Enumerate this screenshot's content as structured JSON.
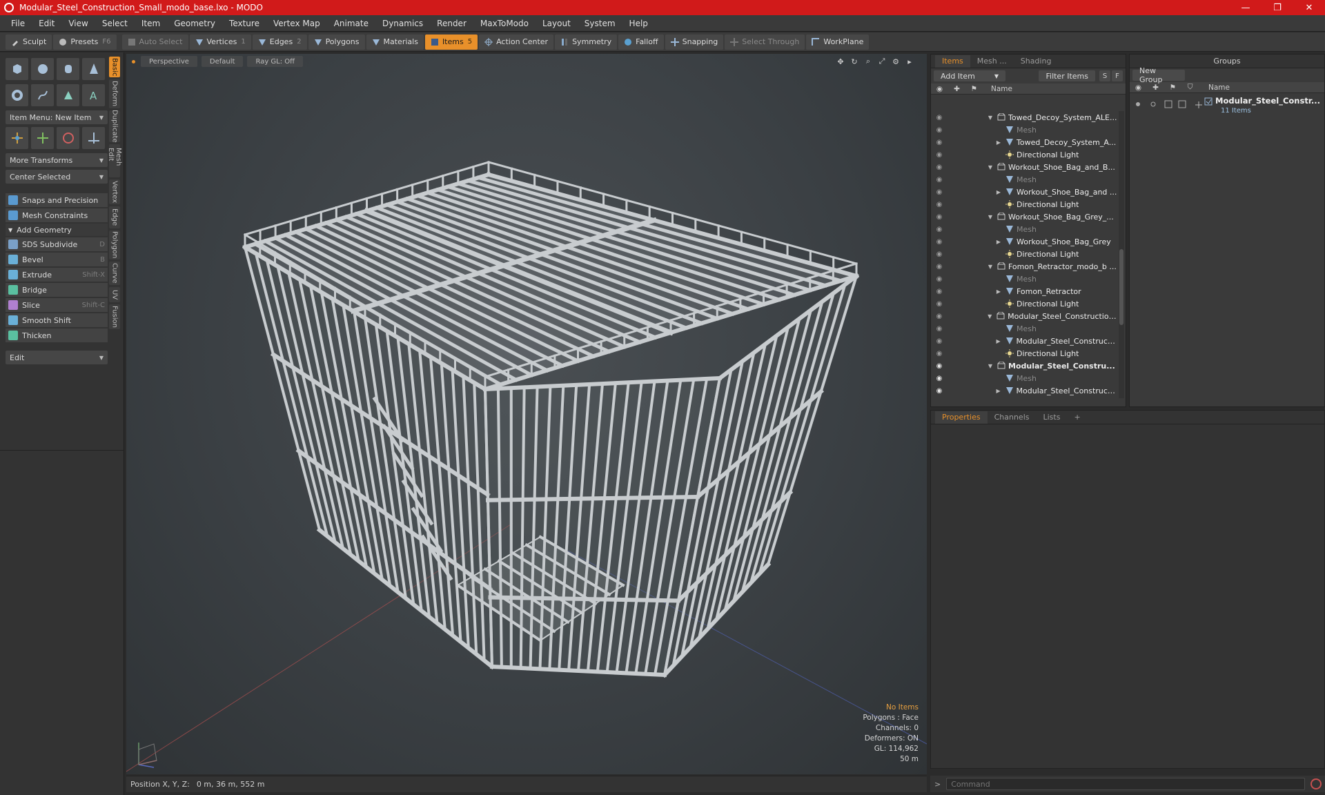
{
  "window": {
    "title": "Modular_Steel_Construction_Small_modo_base.lxo - MODO",
    "controls": [
      "—",
      "❐",
      "✕"
    ]
  },
  "menu": [
    "File",
    "Edit",
    "View",
    "Select",
    "Item",
    "Geometry",
    "Texture",
    "Vertex Map",
    "Animate",
    "Dynamics",
    "Render",
    "MaxToModo",
    "Layout",
    "System",
    "Help"
  ],
  "toolbar": {
    "sculpt": "Sculpt",
    "presets": "Presets",
    "presets_key": "F6",
    "auto_select": "Auto Select",
    "vertices": "Vertices",
    "vertices_count": "1",
    "edges": "Edges",
    "edges_count": "2",
    "polygons": "Polygons",
    "materials": "Materials",
    "items": "Items",
    "items_count": "5",
    "action_center": "Action Center",
    "symmetry": "Symmetry",
    "falloff": "Falloff",
    "snapping": "Snapping",
    "select_through": "Select Through",
    "workplane": "WorkPlane"
  },
  "left_panel": {
    "item_menu": "Item Menu: New Item",
    "more_transforms": "More Transforms",
    "center_selected": "Center Selected",
    "snaps": "Snaps and Precision",
    "mesh_constraints": "Mesh Constraints",
    "add_geometry": "Add Geometry",
    "tools": [
      {
        "label": "SDS Subdivide",
        "key": "D",
        "color": "#7aa0c8"
      },
      {
        "label": "Bevel",
        "key": "B",
        "color": "#6ab0d8"
      },
      {
        "label": "Extrude",
        "key": "Shift-X",
        "color": "#6ab0d8"
      },
      {
        "label": "Bridge",
        "key": "",
        "color": "#5ac0a0"
      },
      {
        "label": "Slice",
        "key": "Shift-C",
        "color": "#b080d0"
      },
      {
        "label": "Smooth Shift",
        "key": "",
        "color": "#6ab0d8"
      },
      {
        "label": "Thicken",
        "key": "",
        "color": "#5ac0a0"
      }
    ],
    "edit": "Edit",
    "vtabs": [
      "Basic",
      "Deform",
      "Duplicate",
      "Mesh Edit",
      "Vertex",
      "Edge",
      "Polygon",
      "Curve",
      "UV",
      "Fusion"
    ]
  },
  "viewport": {
    "tabs": [
      "Perspective",
      "Default",
      "Ray GL: Off"
    ],
    "info": {
      "no_items": "No Items",
      "polygons": "Polygons : Face",
      "channels": "Channels: 0",
      "deformers": "Deformers: ON",
      "gl": "GL: 114,962",
      "scale": "50 m"
    }
  },
  "status": {
    "label": "Position X, Y, Z:",
    "value": "0 m, 36 m, 552 m"
  },
  "items_panel": {
    "tabs": [
      "Items",
      "Mesh ...",
      "Shading"
    ],
    "add_item": "Add Item",
    "filter_items": "Filter Items",
    "s": "S",
    "f": "F",
    "name_col": "Name",
    "rows": [
      {
        "label": "Towed_Decoy_System_ALE...",
        "level": 0,
        "type": "scene",
        "exp": "▼",
        "eye": false,
        "style": ""
      },
      {
        "label": "Mesh",
        "level": 1,
        "type": "mesh",
        "exp": "",
        "eye": false,
        "style": "dim"
      },
      {
        "label": "Towed_Decoy_System_A...",
        "level": 1,
        "type": "mesh",
        "exp": "▶",
        "eye": false,
        "style": ""
      },
      {
        "label": "Directional Light",
        "level": 1,
        "type": "light",
        "exp": "",
        "eye": false,
        "style": ""
      },
      {
        "label": "Workout_Shoe_Bag_and_B...",
        "level": 0,
        "type": "scene",
        "exp": "▼",
        "eye": false,
        "style": ""
      },
      {
        "label": "Mesh",
        "level": 1,
        "type": "mesh",
        "exp": "",
        "eye": false,
        "style": "dim"
      },
      {
        "label": "Workout_Shoe_Bag_and ...",
        "level": 1,
        "type": "mesh",
        "exp": "▶",
        "eye": false,
        "style": ""
      },
      {
        "label": "Directional Light",
        "level": 1,
        "type": "light",
        "exp": "",
        "eye": false,
        "style": ""
      },
      {
        "label": "Workout_Shoe_Bag_Grey_...",
        "level": 0,
        "type": "scene",
        "exp": "▼",
        "eye": false,
        "style": ""
      },
      {
        "label": "Mesh",
        "level": 1,
        "type": "mesh",
        "exp": "",
        "eye": false,
        "style": "dim"
      },
      {
        "label": "Workout_Shoe_Bag_Grey",
        "level": 1,
        "type": "mesh",
        "exp": "▶",
        "eye": false,
        "style": ""
      },
      {
        "label": "Directional Light",
        "level": 1,
        "type": "light",
        "exp": "",
        "eye": false,
        "style": ""
      },
      {
        "label": "Fomon_Retractor_modo_b ...",
        "level": 0,
        "type": "scene",
        "exp": "▼",
        "eye": false,
        "style": ""
      },
      {
        "label": "Mesh",
        "level": 1,
        "type": "mesh",
        "exp": "",
        "eye": false,
        "style": "dim"
      },
      {
        "label": "Fomon_Retractor",
        "level": 1,
        "type": "mesh",
        "exp": "▶",
        "eye": false,
        "style": ""
      },
      {
        "label": "Directional Light",
        "level": 1,
        "type": "light",
        "exp": "",
        "eye": false,
        "style": ""
      },
      {
        "label": "Modular_Steel_Constructio ...",
        "level": 0,
        "type": "scene",
        "exp": "▼",
        "eye": false,
        "style": ""
      },
      {
        "label": "Mesh",
        "level": 1,
        "type": "mesh",
        "exp": "",
        "eye": false,
        "style": "dim"
      },
      {
        "label": "Modular_Steel_Construct...",
        "level": 1,
        "type": "mesh",
        "exp": "▶",
        "eye": false,
        "style": ""
      },
      {
        "label": "Directional Light",
        "level": 1,
        "type": "light",
        "exp": "",
        "eye": false,
        "style": ""
      },
      {
        "label": "Modular_Steel_Constru...",
        "level": 0,
        "type": "scene",
        "exp": "▼",
        "eye": true,
        "style": "bold"
      },
      {
        "label": "Mesh",
        "level": 1,
        "type": "mesh",
        "exp": "",
        "eye": true,
        "style": "dim"
      },
      {
        "label": "Modular_Steel_Construct...",
        "level": 1,
        "type": "mesh",
        "exp": "▶",
        "eye": true,
        "style": ""
      },
      {
        "label": "Directional Light",
        "level": 1,
        "type": "light",
        "exp": "",
        "eye": true,
        "style": ""
      }
    ]
  },
  "groups_panel": {
    "title": "Groups",
    "new_group": "New Group",
    "name_col": "Name",
    "group_name": "Modular_Steel_Constr...",
    "group_count": "11 Items"
  },
  "props_panel": {
    "tabs": [
      "Properties",
      "Channels",
      "Lists"
    ],
    "add": "+"
  },
  "command": {
    "prompt": ">",
    "placeholder": "Command"
  },
  "colors": {
    "accent": "#e8902a",
    "titlebar": "#d11a1a",
    "frame": "#c8cccf"
  }
}
